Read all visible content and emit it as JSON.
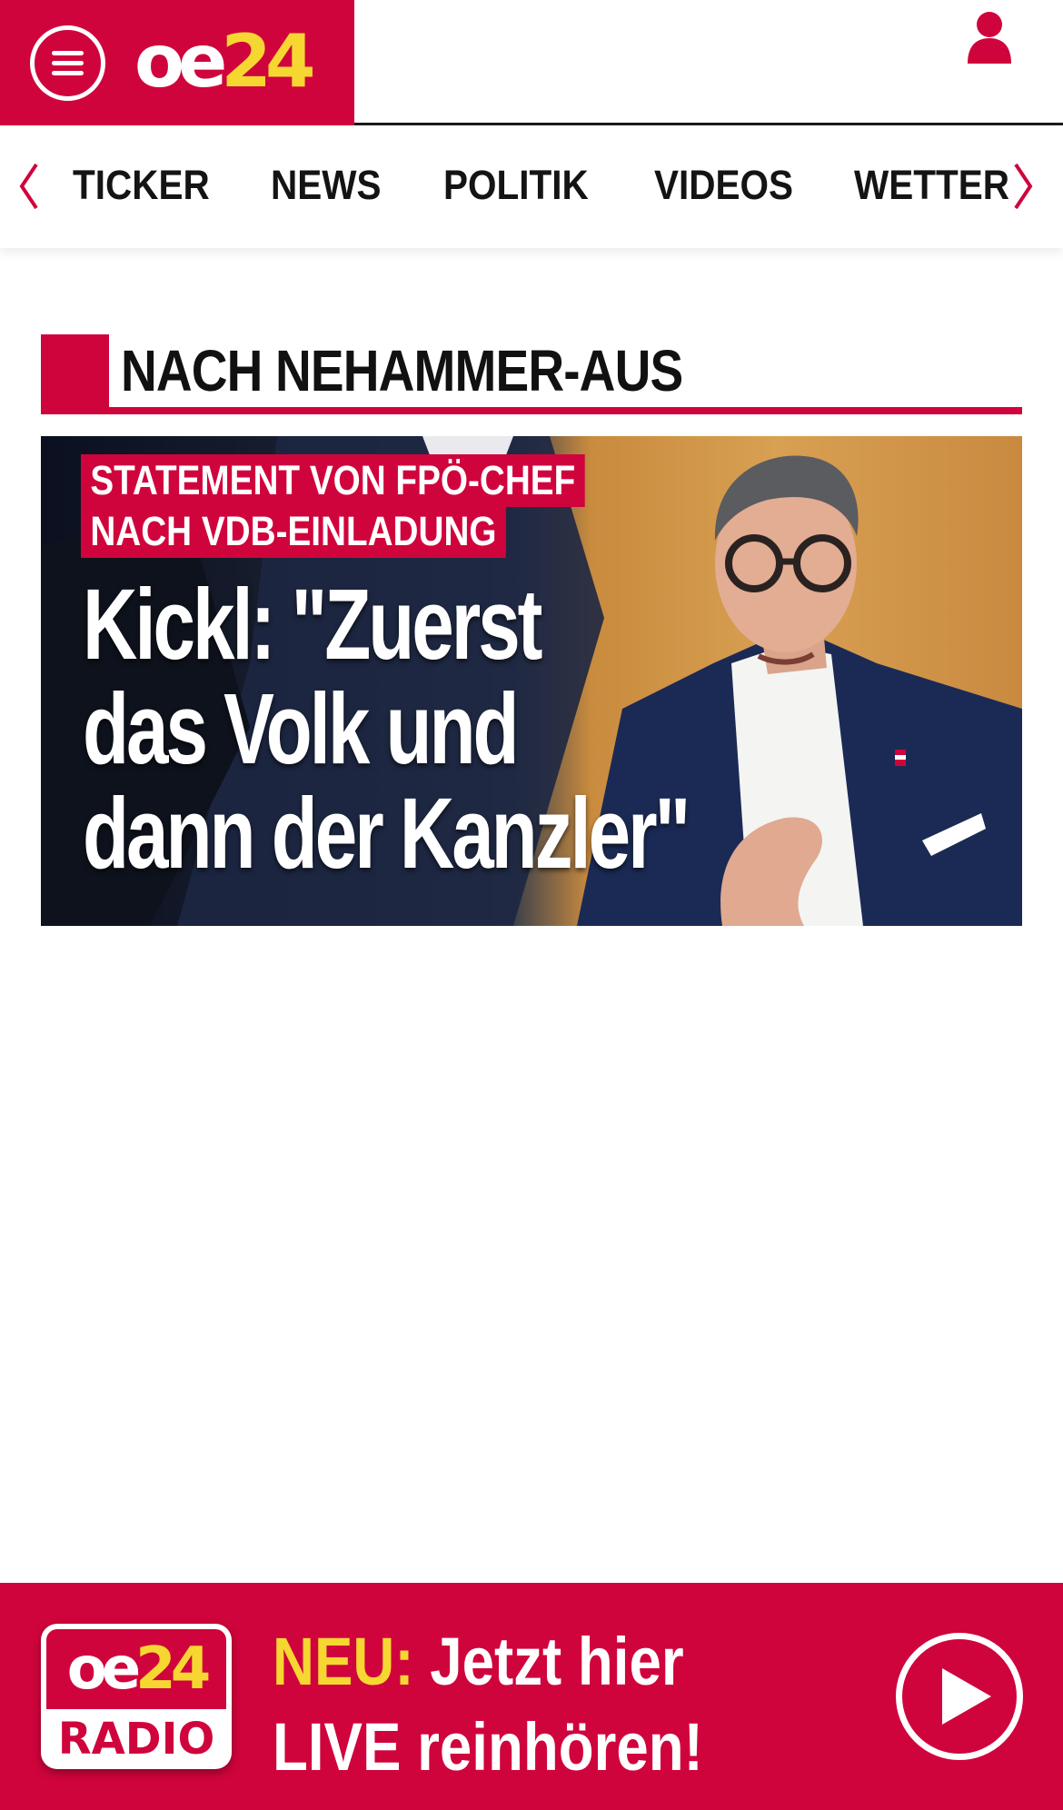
{
  "header": {
    "logo_oe": "oe",
    "logo_num": "24",
    "menu_icon": "hamburger-menu-icon",
    "user_icon": "user-icon"
  },
  "nav": {
    "items": [
      "TICKER",
      "NEWS",
      "POLITIK",
      "VIDEOS",
      "WETTER"
    ],
    "prev_icon": "chevron-left-icon",
    "next_icon": "chevron-right-icon"
  },
  "section": {
    "title": "NACH NEHAMMER-AUS"
  },
  "teaser": {
    "kicker_line1": "STATEMENT VON FPÖ-CHEF",
    "kicker_line2": "NACH VDB-EINLADUNG",
    "headline_line1": "Kickl: \"Zuerst",
    "headline_line2": "das Volk und",
    "headline_line3": "dann der Kanzler\""
  },
  "radio": {
    "logo_oe": "oe",
    "logo_num": "24",
    "logo_label": "RADIO",
    "neu": "NEU:",
    "line1_rest": " Jetzt hier",
    "line2": "LIVE reinhören!",
    "play_icon": "play-icon"
  },
  "colors": {
    "brand_red": "#d0043c",
    "brand_yellow": "#f6d732",
    "text_dark": "#141414"
  }
}
